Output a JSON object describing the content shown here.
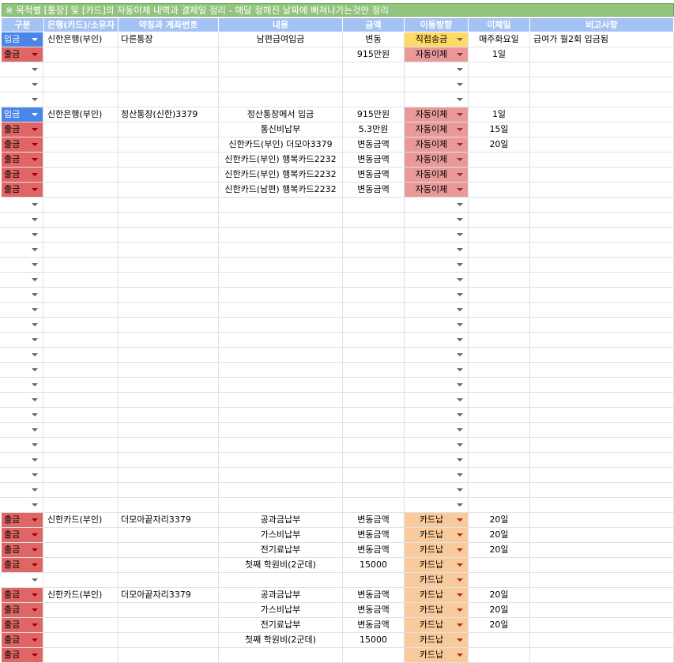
{
  "title": "※ 목적별 [통장] 및 [카드]의 자동이체 내역과 결제일 정리 - 매달 정해진 날짜에 빠져나가는것만 정리",
  "headers": {
    "type": "구분",
    "bank": "은행(카드)/소유자",
    "account": "약칭과 계좌번호",
    "desc": "내용",
    "amount": "금액",
    "direction": "이동방향",
    "day": "이체일",
    "note": "비고사항"
  },
  "colors": {
    "title_bg": "#93c47d",
    "header_bg": "#a4c2f4",
    "deposit_bg": "#4a86e8",
    "withdraw_bg": "#e06666",
    "auto_transfer_bg": "#ea9999",
    "direct_transfer_bg": "#ffd966",
    "card_bg": "#f9cb9c"
  },
  "icons": {
    "dropdown": "chevron-down-icon"
  },
  "rows": [
    {
      "type": "입금",
      "bank": "신한은행(부인)",
      "account": "다른통장",
      "desc": "남편급여입금",
      "amount": "변동",
      "direction": "직접송금",
      "day": "매주화요일",
      "note": "급여가 월2회 입금됨"
    },
    {
      "type": "출금",
      "bank": "",
      "account": "",
      "desc": "",
      "amount": "915만원",
      "direction": "자동이체",
      "day": "1일",
      "note": ""
    },
    {
      "type": "",
      "direction": ""
    },
    {
      "type": "",
      "direction": ""
    },
    {
      "type": "",
      "direction": ""
    },
    {
      "type": "입금",
      "bank": "신한은행(부인)",
      "account": "정산통장(신한)3379",
      "desc": "정산통장에서 입금",
      "amount": "915만원",
      "direction": "자동이체",
      "day": "1일",
      "note": ""
    },
    {
      "type": "출금",
      "bank": "",
      "account": "",
      "desc": "통신비납부",
      "amount": "5.3만원",
      "direction": "자동이체",
      "day": "15일",
      "note": ""
    },
    {
      "type": "출금",
      "bank": "",
      "account": "",
      "desc": "신한카드(부인) 더모아3379",
      "amount": "변동금액",
      "direction": "자동이체",
      "day": "20일",
      "note": ""
    },
    {
      "type": "출금",
      "bank": "",
      "account": "",
      "desc": "신한카드(부인) 행복카드2232",
      "amount": "변동금액",
      "direction": "자동이체",
      "day": "",
      "note": ""
    },
    {
      "type": "출금",
      "bank": "",
      "account": "",
      "desc": "신한카드(부인) 행복카드2232",
      "amount": "변동금액",
      "direction": "자동이체",
      "day": "",
      "note": ""
    },
    {
      "type": "출금",
      "bank": "",
      "account": "",
      "desc": "신한카드(남편) 행복카드2232",
      "amount": "변동금액",
      "direction": "자동이체",
      "day": "",
      "note": ""
    },
    {
      "type": "",
      "direction": ""
    },
    {
      "type": "",
      "direction": ""
    },
    {
      "type": "",
      "direction": ""
    },
    {
      "type": "",
      "direction": ""
    },
    {
      "type": "",
      "direction": ""
    },
    {
      "type": "",
      "direction": ""
    },
    {
      "type": "",
      "direction": ""
    },
    {
      "type": "",
      "direction": ""
    },
    {
      "type": "",
      "direction": ""
    },
    {
      "type": "",
      "direction": ""
    },
    {
      "type": "",
      "direction": ""
    },
    {
      "type": "",
      "direction": ""
    },
    {
      "type": "",
      "direction": ""
    },
    {
      "type": "",
      "direction": ""
    },
    {
      "type": "",
      "direction": ""
    },
    {
      "type": "",
      "direction": ""
    },
    {
      "type": "",
      "direction": ""
    },
    {
      "type": "",
      "direction": ""
    },
    {
      "type": "",
      "direction": ""
    },
    {
      "type": "",
      "direction": ""
    },
    {
      "type": "",
      "direction": ""
    },
    {
      "type": "출금",
      "bank": "신한카드(부인)",
      "account": "더모아끝자리3379",
      "desc": "공과금납부",
      "amount": "변동금액",
      "direction": "카드납",
      "day": "20일",
      "note": ""
    },
    {
      "type": "출금",
      "bank": "",
      "account": "",
      "desc": "가스비납부",
      "amount": "변동금액",
      "direction": "카드납",
      "day": "20일",
      "note": ""
    },
    {
      "type": "출금",
      "bank": "",
      "account": "",
      "desc": "전기료납부",
      "amount": "변동금액",
      "direction": "카드납",
      "day": "20일",
      "note": ""
    },
    {
      "type": "출금",
      "bank": "",
      "account": "",
      "desc": "첫째 학원비(2군데)",
      "amount": "15000",
      "direction": "카드납",
      "day": "",
      "note": ""
    },
    {
      "type": "",
      "bank": "",
      "account": "",
      "desc": "",
      "amount": "",
      "direction": "카드납",
      "day": "",
      "note": ""
    },
    {
      "type": "출금",
      "bank": "신한카드(부인)",
      "account": "더모아끝자리3379",
      "desc": "공과금납부",
      "amount": "변동금액",
      "direction": "카드납",
      "day": "20일",
      "note": ""
    },
    {
      "type": "출금",
      "bank": "",
      "account": "",
      "desc": "가스비납부",
      "amount": "변동금액",
      "direction": "카드납",
      "day": "20일",
      "note": ""
    },
    {
      "type": "출금",
      "bank": "",
      "account": "",
      "desc": "전기료납부",
      "amount": "변동금액",
      "direction": "카드납",
      "day": "20일",
      "note": ""
    },
    {
      "type": "출금",
      "bank": "",
      "account": "",
      "desc": "첫째 학원비(2군데)",
      "amount": "15000",
      "direction": "카드납",
      "day": "",
      "note": ""
    },
    {
      "type": "출금",
      "bank": "",
      "account": "",
      "desc": "",
      "amount": "",
      "direction": "카드납",
      "day": "",
      "note": ""
    }
  ]
}
